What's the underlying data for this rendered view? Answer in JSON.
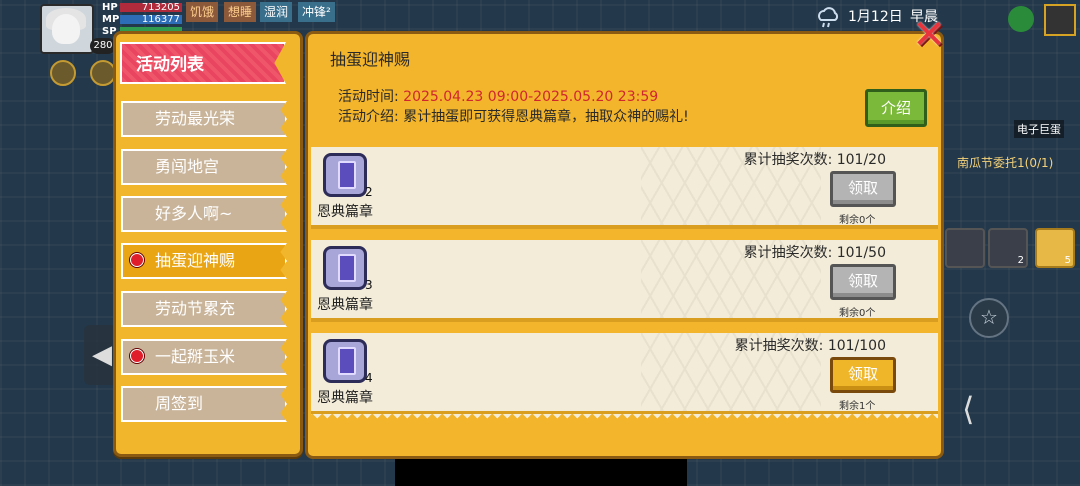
{
  "hud": {
    "level": "280",
    "hp_label": "HP",
    "hp_value": "713205",
    "mp_label": "MP",
    "mp_value": "116377",
    "sp_label": "SP",
    "tags": [
      "饥饿",
      "想睡",
      "湿润",
      "冲锋²"
    ],
    "date": "1月12日",
    "time": "早晨"
  },
  "world": {
    "npc_label": "电子巨蛋",
    "quest_text": "南瓜节委托1(0/1)",
    "slot_counts": [
      "2",
      "5"
    ]
  },
  "sidebar": {
    "title": "活动列表",
    "items": [
      {
        "label": "劳动最光荣",
        "dot": false,
        "active": false
      },
      {
        "label": "勇闯地宫",
        "dot": false,
        "active": false
      },
      {
        "label": "好多人啊~",
        "dot": false,
        "active": false
      },
      {
        "label": "抽蛋迎神赐",
        "dot": true,
        "active": true
      },
      {
        "label": "劳动节累充",
        "dot": false,
        "active": false
      },
      {
        "label": "一起掰玉米",
        "dot": true,
        "active": false
      },
      {
        "label": "周签到",
        "dot": false,
        "active": false
      }
    ]
  },
  "panel": {
    "title": "抽蛋迎神赐",
    "time_label": "活动时间:",
    "time_value": "2025.04.23 09:00-2025.05.20 23:59",
    "desc_label": "活动介绍:",
    "desc_value": "累计抽蛋即可获得恩典篇章，抽取众神的赐礼!",
    "intro_button": "介绍",
    "rewards": [
      {
        "item_name": "恩典篇章",
        "count": "2",
        "progress": "累计抽奖次数: 101/20",
        "button": "领取",
        "state": "claimed",
        "remain": "剩余0个"
      },
      {
        "item_name": "恩典篇章",
        "count": "3",
        "progress": "累计抽奖次数: 101/50",
        "button": "领取",
        "state": "claimed",
        "remain": "剩余0个"
      },
      {
        "item_name": "恩典篇章",
        "count": "4",
        "progress": "累计抽奖次数: 101/100",
        "button": "领取",
        "state": "ready",
        "remain": "剩余1个"
      }
    ]
  },
  "colors": {
    "panel_bg": "#f3b52b",
    "title_pink": "#e94560",
    "time_red": "#d0272f",
    "intro_green": "#7bb93a",
    "claim_gold": "#f0b62a"
  }
}
